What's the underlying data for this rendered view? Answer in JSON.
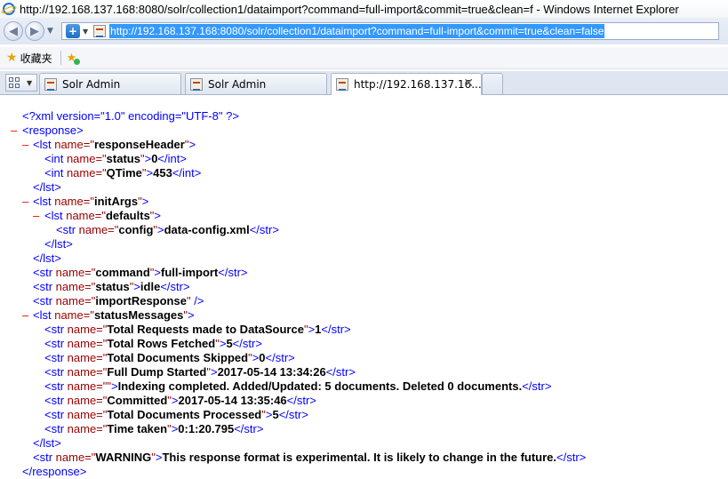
{
  "window": {
    "title": "http://192.168.137.168:8080/solr/collection1/dataimport?command=full-import&commit=true&clean=f - Windows Internet Explorer"
  },
  "address_bar": {
    "url": "http://192.168.137.168:8080/solr/collection1/dataimport?command=full-import&commit=true&clean=false"
  },
  "favorites": {
    "label": "收藏夹"
  },
  "tabs": [
    {
      "label": "Solr Admin",
      "active": false
    },
    {
      "label": "Solr Admin",
      "active": false
    },
    {
      "label": "http://192.168.137.16...",
      "active": true
    }
  ],
  "xml": {
    "declaration": "<?xml version=\"1.0\" encoding=\"UTF-8\" ?>",
    "root_tag": "response",
    "responseHeader": {
      "name": "responseHeader",
      "status": {
        "name": "status",
        "value": "0"
      },
      "qtime": {
        "name": "QTime",
        "value": "453"
      }
    },
    "initArgs": {
      "name": "initArgs",
      "defaults_name": "defaults",
      "config": {
        "name": "config",
        "value": "data-config.xml"
      }
    },
    "command": {
      "name": "command",
      "value": "full-import"
    },
    "status": {
      "name": "status",
      "value": "idle"
    },
    "importResponse": {
      "name": "importResponse"
    },
    "statusMessages": {
      "name": "statusMessages",
      "items": [
        {
          "name": "Total Requests made to DataSource",
          "value": "1"
        },
        {
          "name": "Total Rows Fetched",
          "value": "5"
        },
        {
          "name": "Total Documents Skipped",
          "value": "0"
        },
        {
          "name": "Full Dump Started",
          "value": "2017-05-14 13:34:26"
        },
        {
          "name": "",
          "value": "Indexing completed. Added/Updated: 5 documents. Deleted 0 documents."
        },
        {
          "name": "Committed",
          "value": "2017-05-14 13:35:46"
        },
        {
          "name": "Total Documents Processed",
          "value": "5"
        },
        {
          "name": "Time taken",
          "value": "0:1:20.795"
        }
      ]
    },
    "warning": {
      "name": "WARNING",
      "value": "This response format is experimental. It is likely to change in the future."
    }
  },
  "colors": {
    "tag": "#0000ff",
    "attr_name": "#990000",
    "expander": "#ff0000",
    "url_selection": "#3399ff"
  }
}
